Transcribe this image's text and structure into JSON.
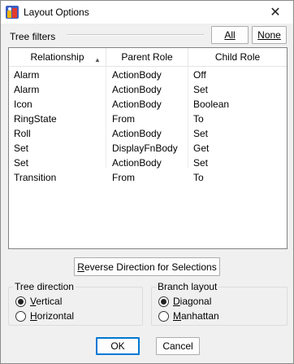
{
  "window": {
    "title": "Layout Options",
    "close_glyph": "✕"
  },
  "tree_filters": {
    "label": "Tree filters",
    "all_label": "All",
    "none_label": "None"
  },
  "table": {
    "columns": [
      "Relationship",
      "Parent Role",
      "Child Role"
    ],
    "sort_indicator": "▲",
    "rows": [
      [
        "Alarm",
        "ActionBody",
        "Off"
      ],
      [
        "Alarm",
        "ActionBody",
        "Set"
      ],
      [
        "Icon",
        "ActionBody",
        "Boolean"
      ],
      [
        "RingState",
        "From",
        "To"
      ],
      [
        "Roll",
        "ActionBody",
        "Set"
      ],
      [
        "Set",
        "DisplayFnBody",
        "Get"
      ],
      [
        "Set",
        "ActionBody",
        "Set"
      ],
      [
        "Transition",
        "From",
        "To"
      ]
    ]
  },
  "reverse_button": {
    "prefix": "R",
    "rest": "everse Direction for Selections"
  },
  "tree_direction": {
    "title": "Tree direction",
    "vertical": {
      "ul": "V",
      "rest": "ertical",
      "checked": true
    },
    "horizontal": {
      "ul": "H",
      "rest": "orizontal",
      "checked": false
    }
  },
  "branch_layout": {
    "title": "Branch layout",
    "diagonal": {
      "ul": "D",
      "rest": "iagonal",
      "checked": true
    },
    "manhattan": {
      "ul": "M",
      "rest": "anhattan",
      "checked": false
    }
  },
  "footer": {
    "ok_label": "OK",
    "cancel_label": "Cancel"
  }
}
